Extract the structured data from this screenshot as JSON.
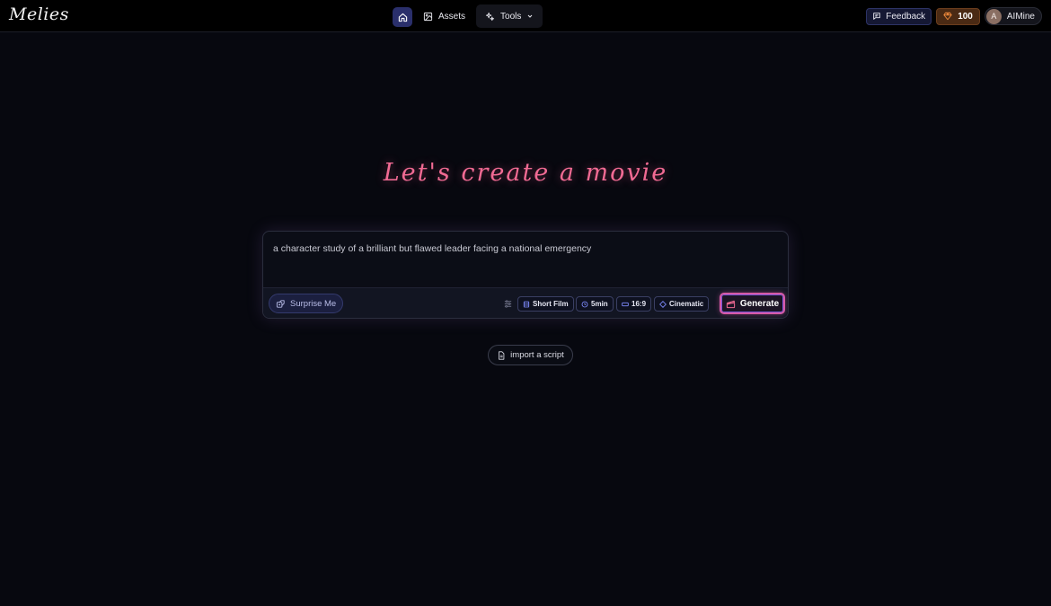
{
  "header": {
    "logo_text": "Melies",
    "nav": {
      "home_icon": "home-icon",
      "assets_label": "Assets",
      "tools_label": "Tools"
    },
    "feedback_label": "Feedback",
    "credits_value": "100",
    "user": {
      "initial": "A",
      "name": "AIMine"
    }
  },
  "main": {
    "title": "Let's create a movie",
    "prompt": {
      "value": "a character study of a brilliant but flawed leader facing a national emergency"
    },
    "toolbar": {
      "surprise_label": "Surprise Me",
      "chips": [
        {
          "label": "Short Film",
          "icon": "film-icon"
        },
        {
          "label": "5min",
          "icon": "clock-icon"
        },
        {
          "label": "16:9",
          "icon": "aspect-ratio-icon"
        },
        {
          "label": "Cinematic",
          "icon": "style-icon"
        }
      ],
      "generate_label": "Generate"
    },
    "import_label": "import a script"
  },
  "colors": {
    "background": "#07080f",
    "accent_pink": "#f06a93",
    "accent_indigo": "#2a2f6b",
    "credits_orange": "#f08a3c"
  }
}
